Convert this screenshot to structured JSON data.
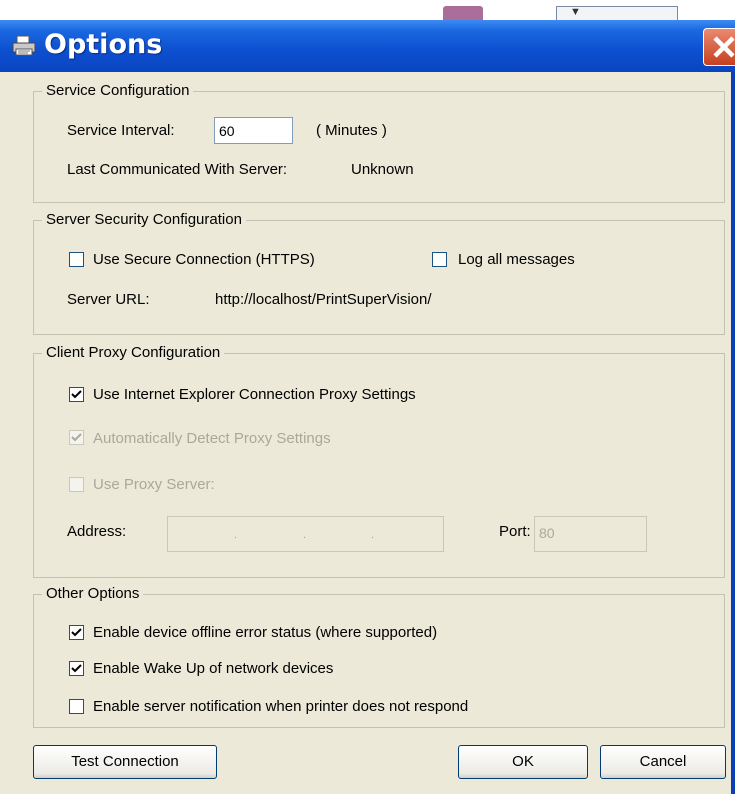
{
  "window": {
    "title": "Options",
    "close_icon": "close-icon",
    "app_icon": "printer-icon"
  },
  "service": {
    "legend": "Service Configuration",
    "interval_label": "Service Interval:",
    "interval_value": "60",
    "interval_unit": "( Minutes )",
    "last_comm_label": "Last Communicated With Server:",
    "last_comm_value": "Unknown"
  },
  "security": {
    "legend": "Server Security Configuration",
    "https_label": "Use Secure Connection (HTTPS)",
    "https_checked": false,
    "log_label": "Log all messages",
    "log_checked": false,
    "url_label": "Server URL:",
    "url_value": "http://localhost/PrintSuperVision/"
  },
  "proxy": {
    "legend": "Client Proxy Configuration",
    "ie_label": "Use Internet Explorer Connection Proxy Settings",
    "ie_checked": true,
    "auto_label": "Automatically Detect Proxy Settings",
    "auto_checked": true,
    "use_proxy_label": "Use Proxy Server:",
    "use_proxy_checked": false,
    "address_label": "Address:",
    "address_value": ". . .",
    "port_label": "Port:",
    "port_value": "80"
  },
  "other": {
    "legend": "Other Options",
    "offline_label": "Enable device offline error status (where supported)",
    "offline_checked": true,
    "wake_label": "Enable Wake Up of network devices",
    "wake_checked": true,
    "notify_label": "Enable server notification when printer does not respond",
    "notify_checked": false
  },
  "buttons": {
    "test": "Test Connection",
    "ok": "OK",
    "cancel": "Cancel"
  },
  "colors": {
    "titlebar": "#0d4fd0",
    "dialog_bg": "#ece9d8",
    "disabled_text": "#aca899"
  }
}
